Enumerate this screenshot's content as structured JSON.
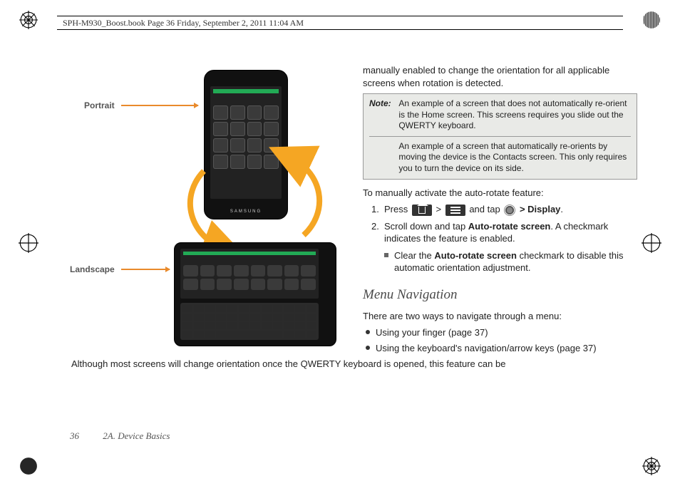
{
  "header": {
    "running_head": "SPH-M930_Boost.book  Page 36  Friday, September 2, 2011  11:04 AM"
  },
  "figure": {
    "label_portrait": "Portrait",
    "label_landscape": "Landscape",
    "phone_brand": "SAMSUNG",
    "caption": "Although most screens will change orientation once the QWERTY keyboard is opened, this feature can be"
  },
  "right": {
    "intro": "manually enabled to change the orientation for all applicable screens when rotation is detected.",
    "note_label": "Note:",
    "note_p1": "An example of a screen that does not automatically re-orient is the Home screen. This screens requires you slide out the QWERTY keyboard.",
    "note_p2": "An example of a screen that automatically re-orients by moving the device is the Contacts screen. This only requires you to turn the device on its side.",
    "activate_lead": "To manually activate the auto-rotate feature:",
    "step1_num": "1.",
    "step1_a": "Press",
    "step1_gt1": ">",
    "step1_b": "and tap",
    "step1_gt2": ">",
    "step1_display": "Display",
    "step1_end": ".",
    "step2_num": "2.",
    "step2_a": "Scroll down and tap ",
    "step2_bold": "Auto-rotate screen",
    "step2_b": ". A checkmark indicates the feature is enabled.",
    "step2_sub_a": "Clear the ",
    "step2_sub_bold": "Auto-rotate screen",
    "step2_sub_b": " checkmark to disable this automatic orientation adjustment.",
    "menu_heading": "Menu Navigation",
    "menu_intro": "There are two ways to navigate through a menu:",
    "menu_b1": "Using your finger (page 37)",
    "menu_b2": "Using the keyboard's navigation/arrow keys (page 37)"
  },
  "footer": {
    "page": "36",
    "section": "2A. Device Basics"
  }
}
